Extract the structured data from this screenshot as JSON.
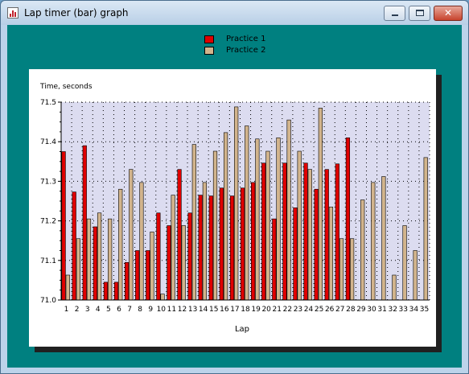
{
  "window": {
    "title": "Lap timer (bar) graph",
    "minimize_glyph": "",
    "maximize_glyph": "",
    "close_glyph": "✕"
  },
  "legend": [
    {
      "label": "Practice 1",
      "color": "#e00000"
    },
    {
      "label": "Practice 2",
      "color": "#d2b48c"
    }
  ],
  "colors": {
    "client_background": "#008080",
    "plot_background": "#dcdcf0",
    "practice_1": "#e00000",
    "practice_2": "#d2b48c"
  },
  "chart_data": {
    "type": "bar",
    "ylabel": "Time, seconds",
    "xlabel": "Lap",
    "ylim": [
      71.0,
      71.5
    ],
    "yticks": [
      "71.0",
      "71.1",
      "71.2",
      "71.3",
      "71.4",
      "71.5"
    ],
    "grid": "dotted",
    "legend_position": "top-center",
    "categories": [
      "1",
      "2",
      "3",
      "4",
      "5",
      "6",
      "7",
      "8",
      "9",
      "10",
      "11",
      "12",
      "13",
      "14",
      "15",
      "16",
      "17",
      "18",
      "19",
      "20",
      "21",
      "22",
      "23",
      "24",
      "25",
      "26",
      "27",
      "28",
      "29",
      "30",
      "31",
      "32",
      "33",
      "34",
      "35"
    ],
    "series": [
      {
        "name": "Practice 1",
        "color": "#e00000",
        "values": [
          71.375,
          71.273,
          71.39,
          71.185,
          71.045,
          71.045,
          71.095,
          71.125,
          71.125,
          71.22,
          71.188,
          71.33,
          71.22,
          71.265,
          71.263,
          71.283,
          71.263,
          71.283,
          71.297,
          71.346,
          71.205,
          71.346,
          71.233,
          71.346,
          71.28,
          71.33,
          71.344,
          71.41,
          null,
          null,
          null,
          null,
          null,
          null,
          null
        ]
      },
      {
        "name": "Practice 2",
        "color": "#d2b48c",
        "values": [
          71.063,
          71.155,
          71.205,
          71.22,
          71.205,
          71.28,
          71.33,
          71.297,
          71.172,
          71.015,
          71.265,
          71.188,
          71.393,
          71.297,
          71.376,
          71.423,
          71.488,
          71.44,
          71.407,
          71.376,
          71.41,
          71.455,
          71.376,
          71.33,
          71.485,
          71.235,
          71.155,
          71.155,
          71.253,
          71.297,
          71.312,
          71.063,
          71.188,
          71.125,
          71.36
        ]
      }
    ]
  }
}
